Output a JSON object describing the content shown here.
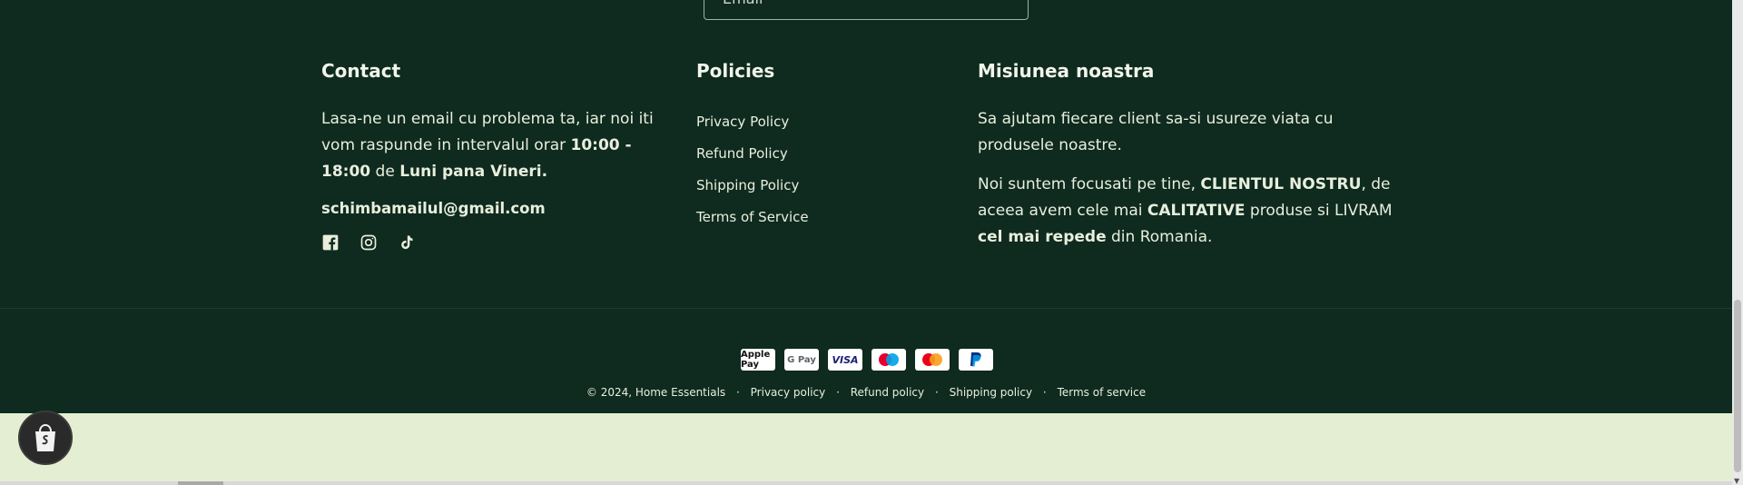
{
  "newsletter": {
    "placeholder": "Email"
  },
  "contact": {
    "heading": "Contact",
    "message_prefix": "Lasa-ne un email cu problema ta, iar noi iti vom raspunde in intervalul orar ",
    "hours": "10:00 - 18:00",
    "message_mid": " de ",
    "days": "Luni pana Vineri.",
    "email": "schimbamailul@gmail.com",
    "socials": [
      "facebook-icon",
      "instagram-icon",
      "tiktok-icon"
    ]
  },
  "policies": {
    "heading": "Policies",
    "links": [
      "Privacy Policy",
      "Refund Policy",
      "Shipping Policy",
      "Terms of Service"
    ]
  },
  "mission": {
    "heading": "Misiunea noastra",
    "p1": "Sa ajutam fiecare client sa-si usureze viata cu produsele noastre.",
    "p2_a": "Noi suntem focusati pe tine, ",
    "p2_b": "CLIENTUL NOSTRU",
    "p2_c": ", de aceea avem cele mai ",
    "p2_d": "CALITATIVE",
    "p2_e": " produse si LIVRAM ",
    "p2_f": "cel mai repede",
    "p2_g": " din Romania."
  },
  "payments": [
    "Apple Pay",
    "G Pay",
    "VISA",
    "Maestro",
    "Mastercard",
    "PayPal"
  ],
  "legal": {
    "copyright": "© 2024, ",
    "store": "Home Essentials",
    "links": [
      "Privacy policy",
      "Refund policy",
      "Shipping policy",
      "Terms of service"
    ]
  },
  "colors": {
    "footer_bg": "#0f2a1f",
    "page_bg": "#e4eed2",
    "text": "#e8efdd"
  }
}
